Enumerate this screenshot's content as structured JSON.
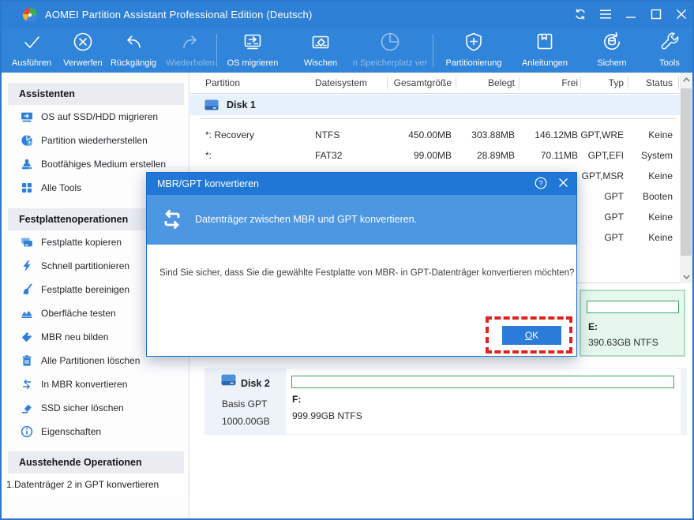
{
  "window": {
    "title": "AOMEI Partition Assistant Professional Edition (Deutsch)",
    "controls": [
      "refresh",
      "menu",
      "minimize",
      "maximize",
      "close"
    ]
  },
  "toolbar": {
    "groups": [
      [
        {
          "icon": "check",
          "label": "Ausführen",
          "disabled": false
        },
        {
          "icon": "discard",
          "label": "Verwerfen",
          "disabled": false
        },
        {
          "icon": "undo",
          "label": "Rückgängig",
          "disabled": false
        },
        {
          "icon": "redo",
          "label": "Wiederholen",
          "disabled": true
        }
      ],
      [
        {
          "icon": "migrate",
          "label": "OS migrieren",
          "disabled": false
        },
        {
          "icon": "wipe",
          "label": "Wischen",
          "disabled": false
        },
        {
          "icon": "pie",
          "label": "n Speicherplatz ver",
          "disabled": true
        }
      ],
      [
        {
          "icon": "shield",
          "label": "Partitionierung",
          "disabled": false
        },
        {
          "icon": "book",
          "label": "Anleitungen",
          "disabled": false
        },
        {
          "icon": "backup",
          "label": "Sichern",
          "disabled": false
        },
        {
          "icon": "wrench",
          "label": "Tools",
          "disabled": false
        }
      ]
    ]
  },
  "sidebar": {
    "sections": [
      {
        "title": "Assistenten",
        "items": [
          {
            "icon": "migrate-os",
            "label": "OS auf SSD/HDD migrieren"
          },
          {
            "icon": "restore",
            "label": "Partition wiederherstellen"
          },
          {
            "icon": "bootable",
            "label": "Bootfähiges Medium erstellen"
          },
          {
            "icon": "alltools",
            "label": "Alle Tools"
          }
        ]
      },
      {
        "title": "Festplattenoperationen",
        "items": [
          {
            "icon": "diskcopy",
            "label": "Festplatte kopieren"
          },
          {
            "icon": "lightning",
            "label": "Schnell partitionieren"
          },
          {
            "icon": "broom",
            "label": "Festplatte bereinigen"
          },
          {
            "icon": "surface",
            "label": "Oberfläche testen"
          },
          {
            "icon": "tag",
            "label": "MBR neu bilden"
          },
          {
            "icon": "trash",
            "label": "Alle Partitionen löschen"
          },
          {
            "icon": "swap",
            "label": "In MBR konvertieren"
          },
          {
            "icon": "eraser",
            "label": "SSD sicher löschen"
          },
          {
            "icon": "info",
            "label": "Eigenschaften"
          }
        ]
      },
      {
        "title": "Ausstehende Operationen",
        "pending": [
          "1.Datenträger 2 in GPT konvertieren"
        ]
      }
    ]
  },
  "table": {
    "columns": [
      {
        "label": "Partition"
      },
      {
        "label": "Dateisystem"
      },
      {
        "label": "Gesamtgröße"
      },
      {
        "label": "Belegt"
      },
      {
        "label": "Frei"
      },
      {
        "label": "Typ"
      },
      {
        "label": "Status"
      }
    ],
    "disk_group_label": "Disk 1",
    "rows": [
      {
        "partition": "*: Recovery",
        "fs": "NTFS",
        "total": "450.00MB",
        "used": "303.88MB",
        "free": "146.12MB",
        "type": "GPT,WRE",
        "status": "Keine"
      },
      {
        "partition": "*:",
        "fs": "FAT32",
        "total": "99.00MB",
        "used": "28.89MB",
        "free": "70.11MB",
        "type": "GPT,EFI",
        "status": "System"
      },
      {
        "partition": "",
        "fs": "",
        "total": "",
        "used": "",
        "free": "",
        "type": "GPT,MSR",
        "status": "Keine"
      },
      {
        "partition": "",
        "fs": "",
        "total": "",
        "used": "",
        "free": "",
        "type": "GPT",
        "status": "Booten"
      },
      {
        "partition": "",
        "fs": "",
        "total": "",
        "used": "",
        "free": "",
        "type": "GPT",
        "status": "Keine"
      },
      {
        "partition": "",
        "fs": "",
        "total": "",
        "used": "",
        "free": "",
        "type": "GPT",
        "status": "Keine"
      }
    ]
  },
  "disk_view": {
    "selected_partition": {
      "letter": "E:",
      "info": "390.63GB NTFS"
    },
    "disk2": {
      "name": "Disk 2",
      "type": "Basis GPT",
      "size": "1000.00GB",
      "partition": {
        "letter": "F:",
        "info": "999.99GB NTFS"
      }
    }
  },
  "dialog": {
    "title": "MBR/GPT konvertieren",
    "header": "Datenträger zwischen MBR und GPT konvertieren.",
    "message": "Sind Sie sicher, dass Sie die gewählte Festplatte von MBR- in GPT-Datenträger konvertieren möchten?",
    "ok_label": "OK"
  },
  "colors": {
    "titlebar": "#2e80d7",
    "toolbar": "#3084da",
    "accent": "#2b7cd8",
    "selection_green": "#3aa55c",
    "annotation_red": "#e02222"
  }
}
